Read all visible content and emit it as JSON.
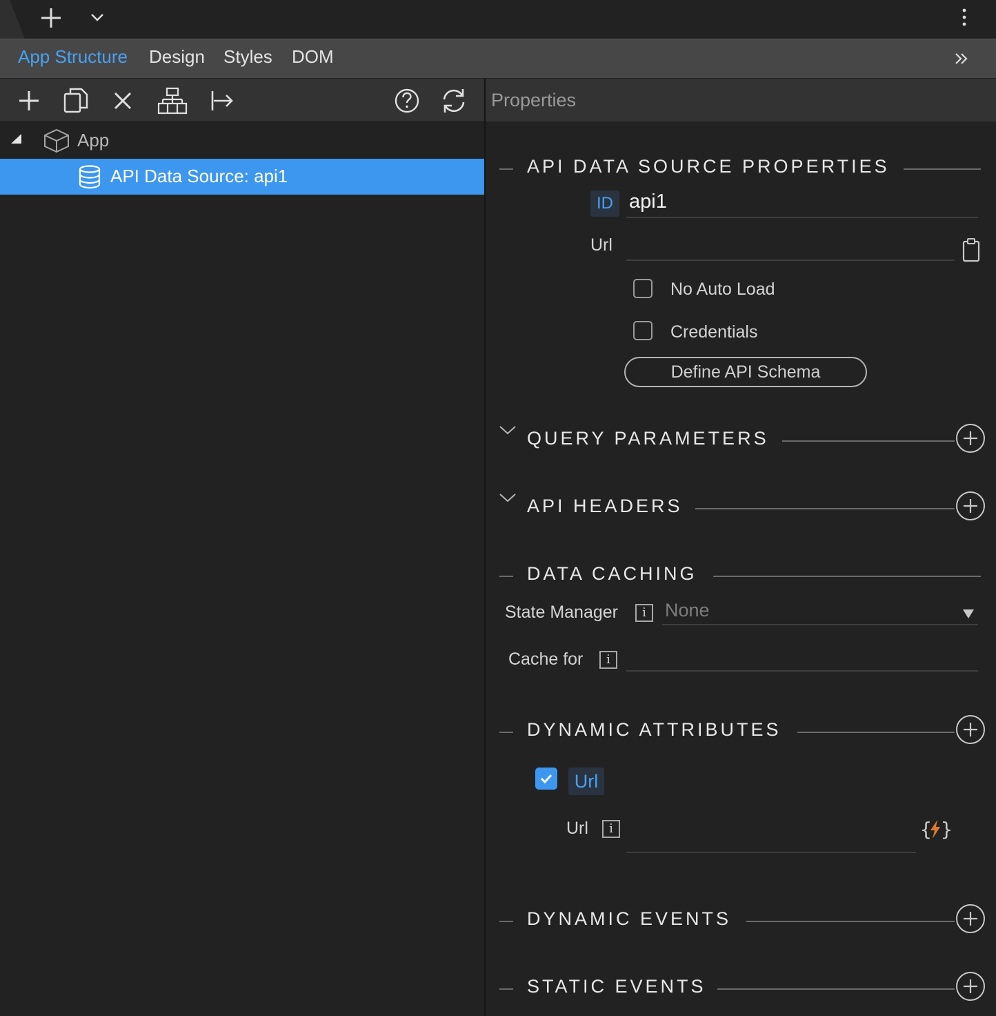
{
  "top": {
    "add_icon": "plus-icon",
    "dropdown_icon": "chevron-down-icon",
    "menu_icon": "kebab-icon"
  },
  "nav_tabs": [
    {
      "label": "App Structure",
      "active": true
    },
    {
      "label": "Design"
    },
    {
      "label": "Styles"
    },
    {
      "label": "DOM"
    }
  ],
  "toolbar": {
    "icons": [
      "plus-icon",
      "copy-icon",
      "close-icon",
      "structure-icon",
      "move-icon",
      "help-icon",
      "refresh-icon"
    ]
  },
  "properties_header": "Properties",
  "tree": {
    "root_label": "App",
    "selected_label": "API Data Source: api1"
  },
  "api_props": {
    "title": "API DATA SOURCE PROPERTIES",
    "id_badge": "ID",
    "id_value": "api1",
    "url_label": "Url",
    "url_value": "",
    "no_auto_load": "No Auto Load",
    "credentials": "Credentials",
    "define_schema": "Define API Schema"
  },
  "query_parameters": {
    "title": "QUERY PARAMETERS"
  },
  "api_headers": {
    "title": "API HEADERS"
  },
  "data_caching": {
    "title": "DATA CACHING",
    "state_manager_label": "State Manager",
    "state_manager_value": "None",
    "cache_for_label": "Cache for",
    "info_glyph": "i"
  },
  "dynamic_attributes": {
    "title": "DYNAMIC ATTRIBUTES",
    "item_label": "Url",
    "item_checked": true,
    "url_label": "Url",
    "url_value": ""
  },
  "dynamic_events": {
    "title": "DYNAMIC EVENTS"
  },
  "static_events": {
    "title": "STATIC EVENTS"
  },
  "colors": {
    "accent": "#3d97ef",
    "link": "#49a1f0",
    "bg": "#222222",
    "orange": "#e07a2a"
  }
}
